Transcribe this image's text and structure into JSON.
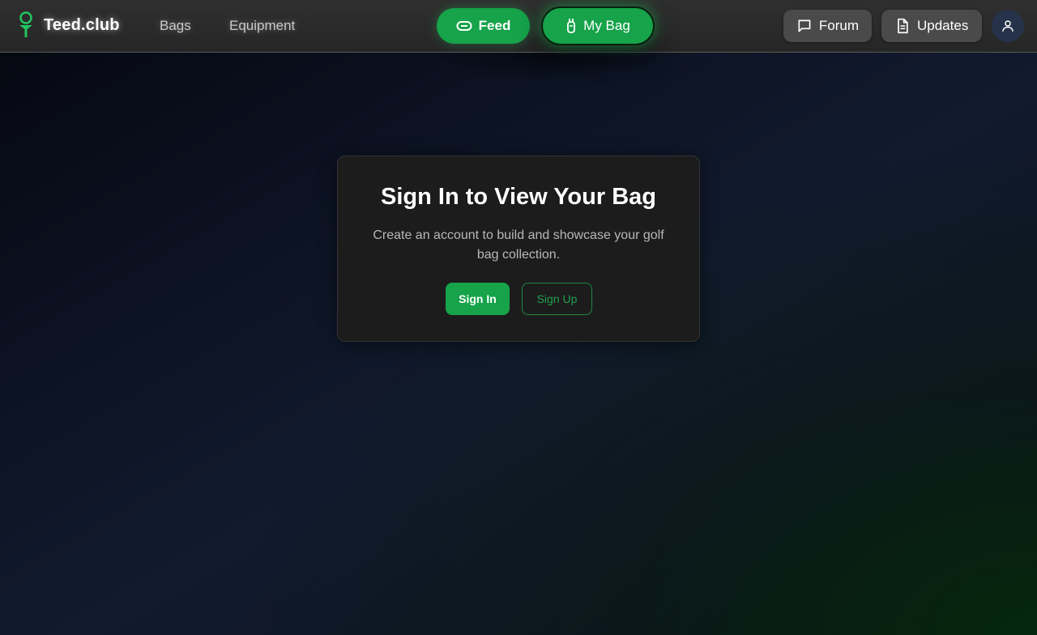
{
  "header": {
    "brand": "Teed.club",
    "nav": {
      "bags": "Bags",
      "equipment": "Equipment"
    },
    "feed_label": "Feed",
    "my_bag_label": "My Bag",
    "forum_label": "Forum",
    "updates_label": "Updates",
    "icons": {
      "logo": "golf-tee-icon",
      "feed": "ticket-icon",
      "my_bag": "golf-bag-icon",
      "forum": "message-square-icon",
      "updates": "file-text-icon",
      "avatar": "user-icon"
    }
  },
  "card": {
    "title": "Sign In to View Your Bag",
    "description": "Create an account to build and showcase your golf bag collection.",
    "sign_in_label": "Sign In",
    "sign_up_label": "Sign Up"
  },
  "colors": {
    "accent": "#16a34a",
    "accent_text": "#22a04d",
    "card_bg": "#1c1c1c",
    "header_bg": "#2b2b2b"
  }
}
